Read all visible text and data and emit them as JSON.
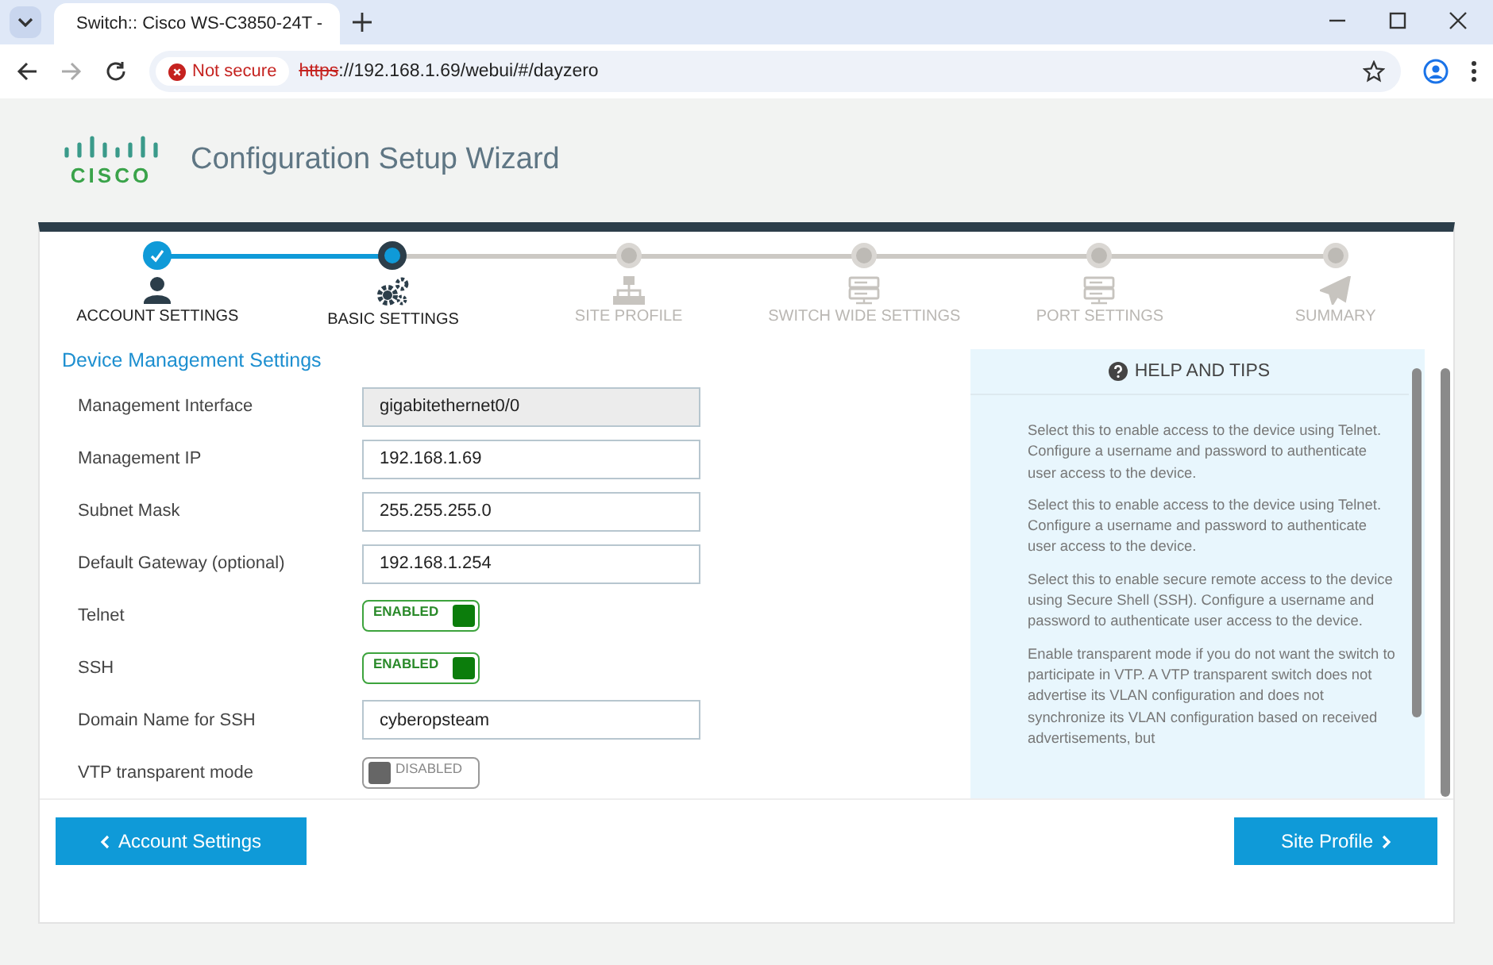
{
  "browser": {
    "tab_title": "Switch:: Cisco WS-C3850-24T -",
    "security": "Not secure",
    "url_scheme": "https",
    "url_rest": "://192.168.1.69/webui/#/dayzero"
  },
  "header": {
    "logo_text": "CISCO",
    "title": "Configuration Setup Wizard"
  },
  "steps": [
    {
      "label": "ACCOUNT SETTINGS",
      "completed": true,
      "selected": false
    },
    {
      "label": "BASIC SETTINGS",
      "completed": false,
      "selected": true
    },
    {
      "label": "SITE PROFILE",
      "completed": false,
      "selected": false
    },
    {
      "label": "SWITCH WIDE SETTINGS",
      "completed": false,
      "selected": false
    },
    {
      "label": "PORT SETTINGS",
      "completed": false,
      "selected": false
    },
    {
      "label": "SUMMARY",
      "completed": false,
      "selected": false
    }
  ],
  "section_title": "Device Management Settings",
  "fields": [
    {
      "kind": "input",
      "label": "Management Interface",
      "value": "gigabitethernet0/0",
      "disabled": true
    },
    {
      "kind": "input",
      "label": "Management IP",
      "value": "192.168.1.69",
      "disabled": false
    },
    {
      "kind": "input",
      "label": "Subnet Mask",
      "value": "255.255.255.0",
      "disabled": false
    },
    {
      "kind": "input",
      "label": "Default Gateway (optional)",
      "value": "192.168.1.254",
      "disabled": false
    },
    {
      "kind": "toggle",
      "label": "Telnet",
      "on": true,
      "state_text": "ENABLED"
    },
    {
      "kind": "toggle",
      "label": "SSH",
      "on": true,
      "state_text": "ENABLED"
    },
    {
      "kind": "input",
      "label": "Domain Name for SSH",
      "value": "cyberopsteam",
      "disabled": false
    },
    {
      "kind": "toggle",
      "label": "VTP transparent mode",
      "on": false,
      "state_text": "DISABLED"
    }
  ],
  "help": {
    "title": "HELP AND TIPS",
    "paragraphs": [
      "Select this to enable access to the device using Telnet. Configure a username and password to authenticate user access to the device.",
      "Select this to enable access to the device using Telnet. Configure a username and password to authenticate user access to the device.",
      "Select this to enable secure remote access to the device using Secure Shell (SSH). Configure a username and password to authenticate user access to the device.",
      "Enable transparent mode if you do not want the switch to participate in VTP. A VTP transparent switch does not advertise its VLAN configuration and does not synchronize its VLAN configuration based on received advertisements, but"
    ]
  },
  "buttons": {
    "back": "Account Settings",
    "next": "Site Profile"
  }
}
